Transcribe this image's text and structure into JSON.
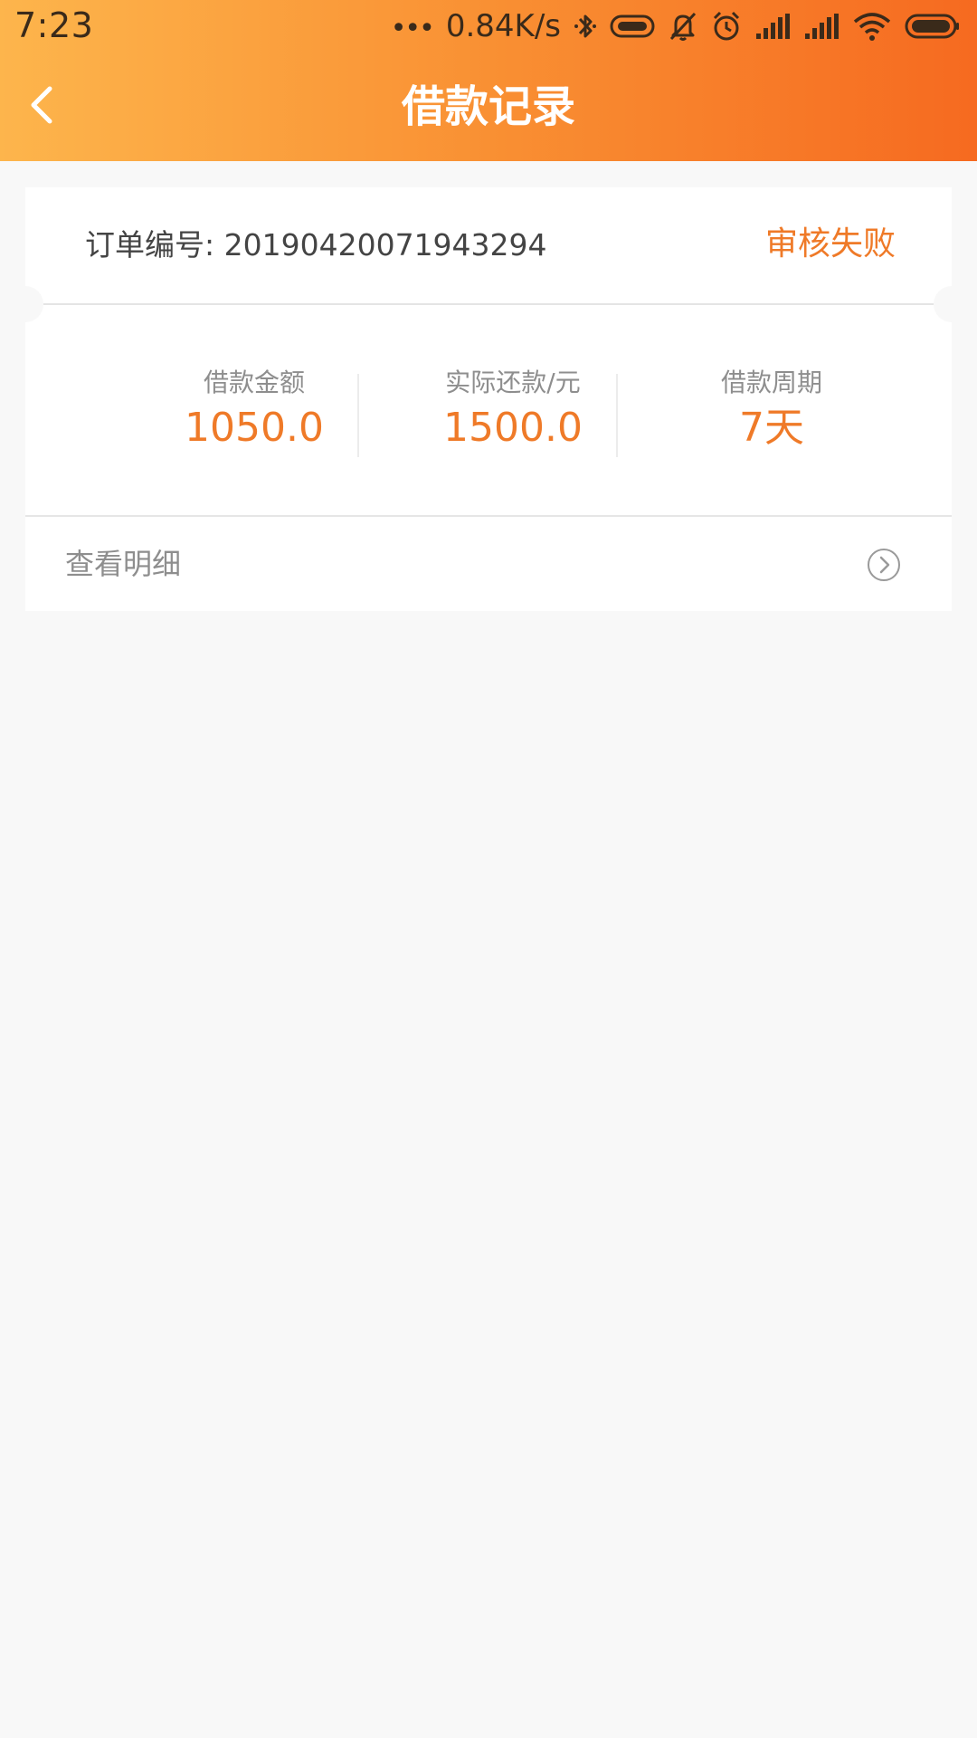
{
  "status_bar": {
    "time": "7:23",
    "dots": "•••",
    "speed": "0.84K/s",
    "icons": [
      "bluetooth-icon",
      "vibrate-icon",
      "mute-icon",
      "alarm-icon",
      "signal-icon",
      "signal-icon",
      "wifi-icon",
      "battery-icon"
    ]
  },
  "header": {
    "title": "借款记录",
    "back_icon": "chevron-left-icon"
  },
  "order": {
    "label": "订单编号: 20190420071943294",
    "status": "审核失败"
  },
  "stats": [
    {
      "label": "借款金额",
      "value": "1050.0"
    },
    {
      "label": "实际还款/元",
      "value": "1500.0"
    },
    {
      "label": "借款周期",
      "value": "7天"
    }
  ],
  "detail": {
    "label": "查看明细",
    "icon": "chevron-right-circle-icon"
  },
  "colors": {
    "accent": "#ef7a28",
    "header_gradient_start": "#fdb54c",
    "header_gradient_end": "#f66a20",
    "background": "#f8f8f8"
  }
}
